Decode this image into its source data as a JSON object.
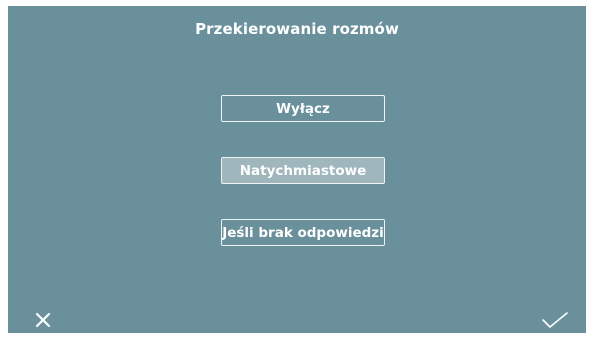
{
  "header": {
    "title": "Przekierowanie rozmów"
  },
  "options": [
    {
      "label": "Wyłącz",
      "selected": false
    },
    {
      "label": "Natychmiastowe",
      "selected": true
    },
    {
      "label": "Jeśli brak odpowiedzi",
      "selected": false
    }
  ],
  "footer": {
    "cancel_icon": "close-icon",
    "confirm_icon": "check-icon"
  },
  "colors": {
    "background": "#6a909c",
    "selected_fill": "#9fb6bd",
    "text": "#ffffff"
  }
}
